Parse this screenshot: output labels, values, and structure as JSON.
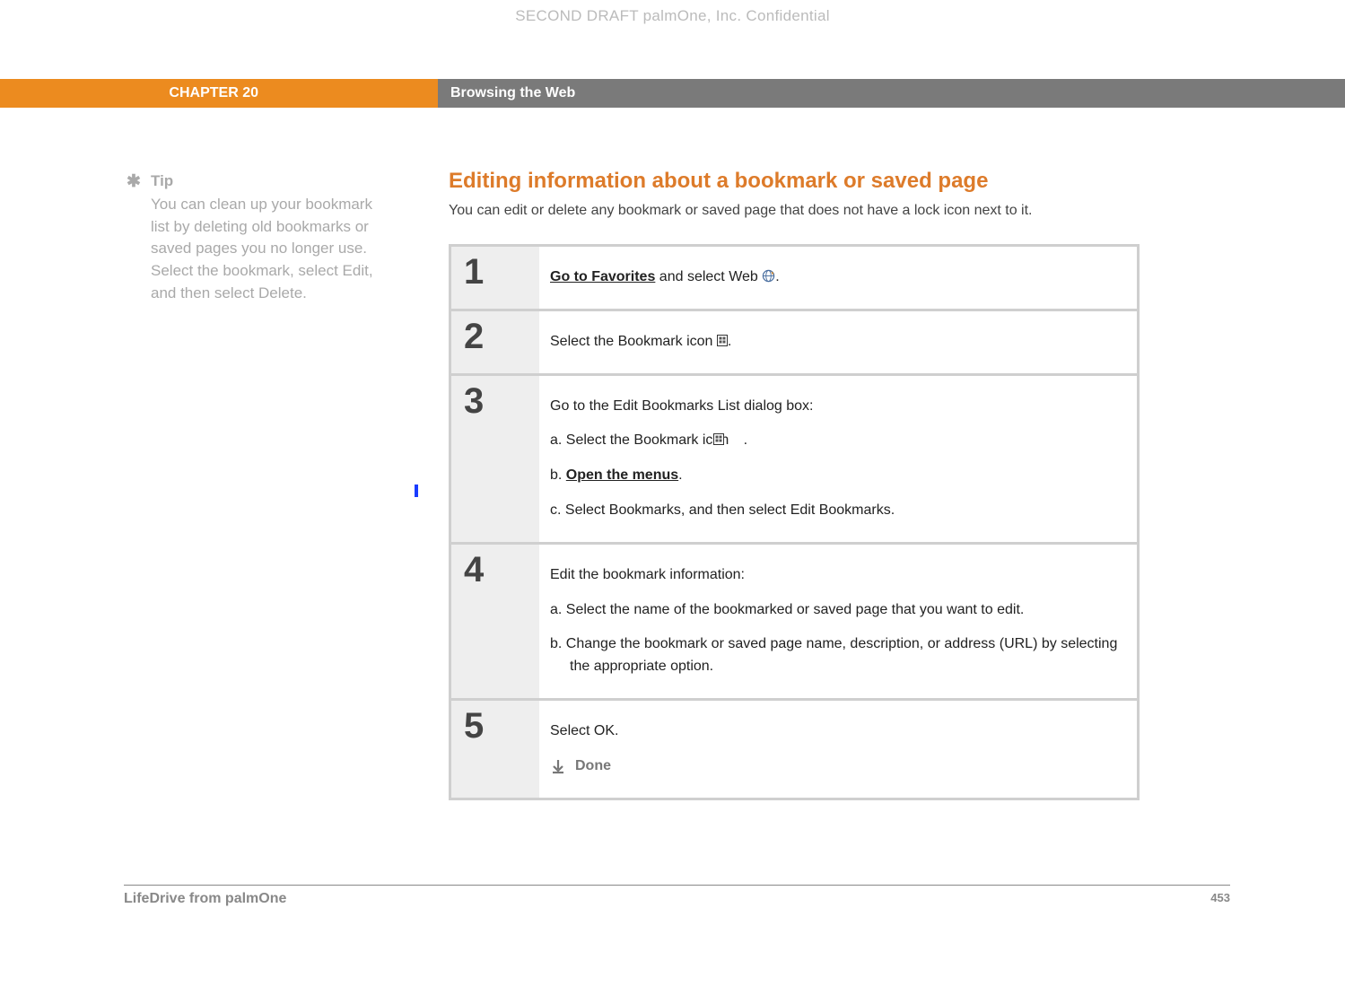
{
  "confidential": "SECOND DRAFT palmOne, Inc.  Confidential",
  "chapter": "CHAPTER 20",
  "chapter_title": "Browsing the Web",
  "tip": {
    "label": "Tip",
    "body": "You can clean up your bookmark list by deleting old bookmarks or saved pages you no longer use. Select the bookmark, select Edit, and then select Delete."
  },
  "section": {
    "title": "Editing information about a bookmark or saved page",
    "intro": "You can edit or delete any bookmark or saved page that does not have a lock icon next to it."
  },
  "steps": [
    {
      "num": "1",
      "text_link": "Go to Favorites",
      "text_after": " and select Web ",
      "period": "."
    },
    {
      "num": "2",
      "text": "Select the Bookmark icon ",
      "period": "."
    },
    {
      "num": "3",
      "lead": "Go to the Edit Bookmarks List dialog box:",
      "a_pre": "a.  Select the Bookmark icon ",
      "a_post": ".",
      "b_pre": "b.  ",
      "b_link": "Open the menus",
      "b_post": ".",
      "c": "c.  Select Bookmarks, and then select Edit Bookmarks."
    },
    {
      "num": "4",
      "lead": "Edit the bookmark information:",
      "a": "a.  Select the name of the bookmarked or saved page that you want to edit.",
      "b": "b.  Change the bookmark or saved page name, description, or address (URL) by selecting the appropriate option."
    },
    {
      "num": "5",
      "text": "Select OK.",
      "done": "Done"
    }
  ],
  "footer": {
    "product": "LifeDrive from palmOne",
    "page": "453"
  }
}
